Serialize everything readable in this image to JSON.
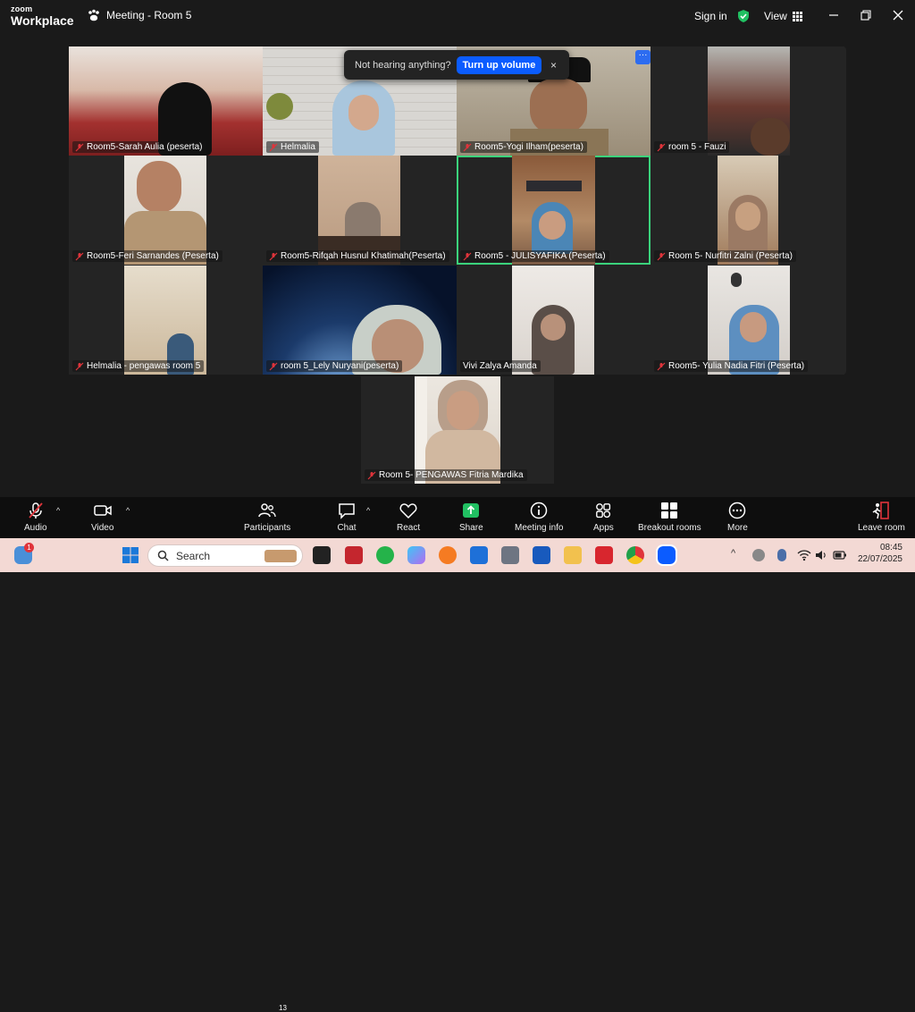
{
  "app": {
    "brand_small": "zoom",
    "brand_big": "Workplace",
    "meeting_title": "Meeting - Room 5"
  },
  "titlebar": {
    "signin": "Sign in",
    "view": "View"
  },
  "toast": {
    "message": "Not hearing anything?",
    "button": "Turn up volume",
    "close": "×"
  },
  "participants": [
    {
      "name": "Room5-Sarah Aulia (peserta)"
    },
    {
      "name": "Helmalia"
    },
    {
      "name": "Room5-Yogi Ilham(peserta)"
    },
    {
      "name": "room 5 - Fauzi"
    },
    {
      "name": "Room5-Feri Sarnandes (Peserta)"
    },
    {
      "name": "Room5-Rifqah Husnul Khatimah(Peserta)"
    },
    {
      "name": "Room5 - JULISYAFIKA (Peserta)"
    },
    {
      "name": "Room 5- Nurfitri Zalni (Peserta)"
    },
    {
      "name": "Helmalia - pengawas room 5"
    },
    {
      "name": "room 5_Lely Nuryani(peserta)"
    },
    {
      "name": "Vivi Zalya Amanda"
    },
    {
      "name": "Room5- Yulia Nadia Fitri (Peserta)"
    },
    {
      "name": "Room 5- PENGAWAS Fitria Mardika"
    }
  ],
  "toolbar": {
    "audio": "Audio",
    "video": "Video",
    "participants": "Participants",
    "participants_count": "13",
    "chat": "Chat",
    "react": "React",
    "share": "Share",
    "meeting_info": "Meeting info",
    "apps": "Apps",
    "breakout": "Breakout rooms",
    "more": "More",
    "leave": "Leave room"
  },
  "taskbar": {
    "search_placeholder": "Search",
    "notif_badge": "1",
    "time": "08:45",
    "date": "22/07/2025"
  },
  "colors": {
    "accent": "#0b5cff",
    "active_speaker": "#3bd37c",
    "share_green": "#21c062",
    "mic_red": "#e0343b"
  }
}
